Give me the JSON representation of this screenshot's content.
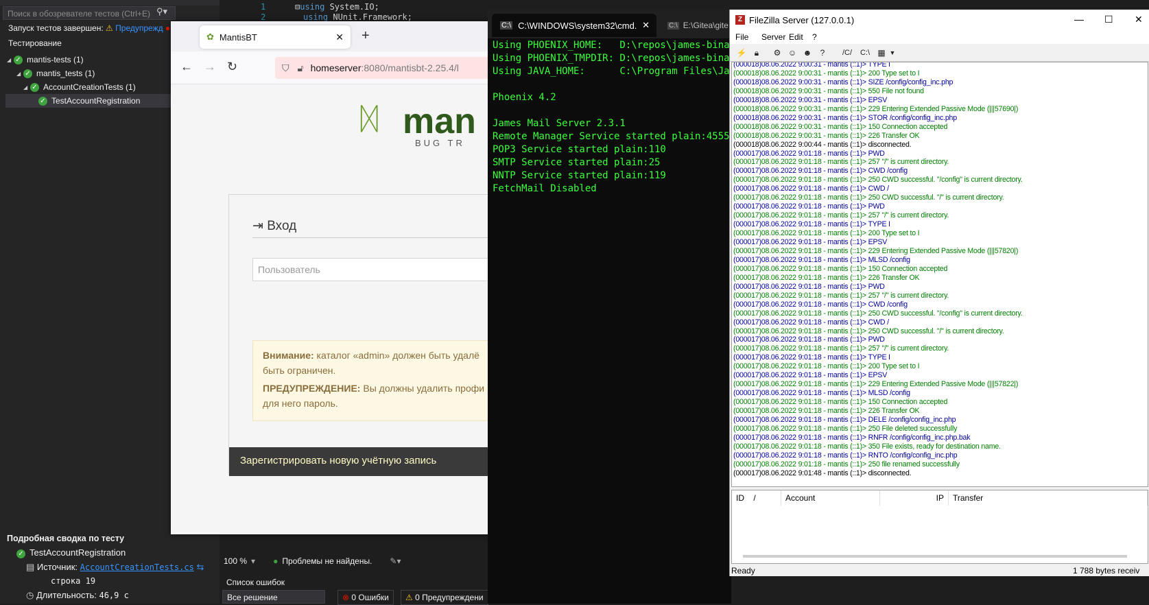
{
  "vs": {
    "search_placeholder": "Поиск в обозревателе тестов (Ctrl+E)",
    "status_text": "Запуск тестов завершен:",
    "status_warning": "Предупрежд",
    "group_header": "Тестирование",
    "tree": [
      {
        "label": "mantis-tests (1)"
      },
      {
        "label": "mantis_tests (1)"
      },
      {
        "label": "AccountCreationTests (1)"
      },
      {
        "label": "TestAccountRegistration"
      }
    ],
    "code": [
      {
        "num": "1",
        "kw": "using",
        "rest": " System.IO;"
      },
      {
        "num": "2",
        "kw": "using",
        "rest": " NUnit.Framework;"
      }
    ],
    "summary": {
      "title": "Подробная сводка по тесту",
      "test_name": "TestAccountRegistration",
      "source_label": "Источник:",
      "source_link": "AccountCreationTests.cs",
      "line_label": "строка",
      "line_num": "19",
      "duration_label": "Длительность:",
      "duration": "46,9 с"
    },
    "bottom": {
      "zoom": "100 %",
      "problems": "Проблемы не найдены.",
      "errors_title": "Список ошибок",
      "scope": "Все решение",
      "errors": "0 Ошибки",
      "warnings": "0 Предупреждени"
    }
  },
  "browser": {
    "tab_title": "MantisBT",
    "url_host": "homeserver",
    "url_rest": ":8080/mantisbt-2.25.4/l",
    "logo_text": "man",
    "logo_sub": "BUG TR",
    "login_title": "Вход",
    "username_placeholder": "Пользователь",
    "alert_label1": "Внимание:",
    "alert_text1": " каталог «admin» должен быть удалё быть ограничен.",
    "alert_label2": "ПРЕДУПРЕЖДЕНИЕ:",
    "alert_text2": " Вы должны удалить профи для него пароль.",
    "register_link": "Зарегистрировать новую учётную запись"
  },
  "cmd": {
    "tab_title": "C:\\WINDOWS\\system32\\cmd.",
    "tab2_title": "E:\\Gitea\\gite",
    "lines": [
      "Using PHOENIX_HOME:   D:\\repos\\james-binary",
      "Using PHOENIX_TMPDIR: D:\\repos\\james-binary",
      "Using JAVA_HOME:      C:\\Program Files\\Java",
      "",
      "Phoenix 4.2",
      "",
      "James Mail Server 2.3.1",
      "Remote Manager Service started plain:4555",
      "POP3 Service started plain:110",
      "SMTP Service started plain:25",
      "NNTP Service started plain:119",
      "FetchMail Disabled"
    ]
  },
  "filezilla": {
    "title": "FileZilla Server (127.0.0.1)",
    "menu": [
      "File",
      "Server",
      "Edit",
      "?"
    ],
    "toolbar_paths": [
      "/C/",
      "C:\\"
    ],
    "log": [
      {
        "t": "(000018)08.06.2022 9:00:31 - mantis (::1)> TYPE I",
        "k": "c-cmd"
      },
      {
        "t": "(000018)08.06.2022 9:00:31 - mantis (::1)> 200 Type set to I",
        "k": "c-res"
      },
      {
        "t": "(000018)08.06.2022 9:00:31 - mantis (::1)> SIZE /config/config_inc.php",
        "k": "c-cmd"
      },
      {
        "t": "(000018)08.06.2022 9:00:31 - mantis (::1)> 550 File not found",
        "k": "c-res"
      },
      {
        "t": "(000018)08.06.2022 9:00:31 - mantis (::1)> EPSV",
        "k": "c-cmd"
      },
      {
        "t": "(000018)08.06.2022 9:00:31 - mantis (::1)> 229 Entering Extended Passive Mode (|||57690|)",
        "k": "c-res"
      },
      {
        "t": "(000018)08.06.2022 9:00:31 - mantis (::1)> STOR /config/config_inc.php",
        "k": "c-cmd"
      },
      {
        "t": "(000018)08.06.2022 9:00:31 - mantis (::1)> 150 Connection accepted",
        "k": "c-res"
      },
      {
        "t": "(000018)08.06.2022 9:00:31 - mantis (::1)> 226 Transfer OK",
        "k": "c-res"
      },
      {
        "t": "(000018)08.06.2022 9:00:44 - mantis (::1)> disconnected.",
        "k": "c-plain"
      },
      {
        "t": "(000017)08.06.2022 9:01:18 - mantis (::1)> PWD",
        "k": "c-cmd"
      },
      {
        "t": "(000017)08.06.2022 9:01:18 - mantis (::1)> 257 \"/\" is current directory.",
        "k": "c-res"
      },
      {
        "t": "(000017)08.06.2022 9:01:18 - mantis (::1)> CWD /config",
        "k": "c-cmd"
      },
      {
        "t": "(000017)08.06.2022 9:01:18 - mantis (::1)> 250 CWD successful. \"/config\" is current directory.",
        "k": "c-res"
      },
      {
        "t": "(000017)08.06.2022 9:01:18 - mantis (::1)> CWD /",
        "k": "c-cmd"
      },
      {
        "t": "(000017)08.06.2022 9:01:18 - mantis (::1)> 250 CWD successful. \"/\" is current directory.",
        "k": "c-res"
      },
      {
        "t": "(000017)08.06.2022 9:01:18 - mantis (::1)> PWD",
        "k": "c-cmd"
      },
      {
        "t": "(000017)08.06.2022 9:01:18 - mantis (::1)> 257 \"/\" is current directory.",
        "k": "c-res"
      },
      {
        "t": "(000017)08.06.2022 9:01:18 - mantis (::1)> TYPE I",
        "k": "c-cmd"
      },
      {
        "t": "(000017)08.06.2022 9:01:18 - mantis (::1)> 200 Type set to I",
        "k": "c-res"
      },
      {
        "t": "(000017)08.06.2022 9:01:18 - mantis (::1)> EPSV",
        "k": "c-cmd"
      },
      {
        "t": "(000017)08.06.2022 9:01:18 - mantis (::1)> 229 Entering Extended Passive Mode (|||57820|)",
        "k": "c-res"
      },
      {
        "t": "(000017)08.06.2022 9:01:18 - mantis (::1)> MLSD /config",
        "k": "c-cmd"
      },
      {
        "t": "(000017)08.06.2022 9:01:18 - mantis (::1)> 150 Connection accepted",
        "k": "c-res"
      },
      {
        "t": "(000017)08.06.2022 9:01:18 - mantis (::1)> 226 Transfer OK",
        "k": "c-res"
      },
      {
        "t": "(000017)08.06.2022 9:01:18 - mantis (::1)> PWD",
        "k": "c-cmd"
      },
      {
        "t": "(000017)08.06.2022 9:01:18 - mantis (::1)> 257 \"/\" is current directory.",
        "k": "c-res"
      },
      {
        "t": "(000017)08.06.2022 9:01:18 - mantis (::1)> CWD /config",
        "k": "c-cmd"
      },
      {
        "t": "(000017)08.06.2022 9:01:18 - mantis (::1)> 250 CWD successful. \"/config\" is current directory.",
        "k": "c-res"
      },
      {
        "t": "(000017)08.06.2022 9:01:18 - mantis (::1)> CWD /",
        "k": "c-cmd"
      },
      {
        "t": "(000017)08.06.2022 9:01:18 - mantis (::1)> 250 CWD successful. \"/\" is current directory.",
        "k": "c-res"
      },
      {
        "t": "(000017)08.06.2022 9:01:18 - mantis (::1)> PWD",
        "k": "c-cmd"
      },
      {
        "t": "(000017)08.06.2022 9:01:18 - mantis (::1)> 257 \"/\" is current directory.",
        "k": "c-res"
      },
      {
        "t": "(000017)08.06.2022 9:01:18 - mantis (::1)> TYPE I",
        "k": "c-cmd"
      },
      {
        "t": "(000017)08.06.2022 9:01:18 - mantis (::1)> 200 Type set to I",
        "k": "c-res"
      },
      {
        "t": "(000017)08.06.2022 9:01:18 - mantis (::1)> EPSV",
        "k": "c-cmd"
      },
      {
        "t": "(000017)08.06.2022 9:01:18 - mantis (::1)> 229 Entering Extended Passive Mode (|||57822|)",
        "k": "c-res"
      },
      {
        "t": "(000017)08.06.2022 9:01:18 - mantis (::1)> MLSD /config",
        "k": "c-cmd"
      },
      {
        "t": "(000017)08.06.2022 9:01:18 - mantis (::1)> 150 Connection accepted",
        "k": "c-res"
      },
      {
        "t": "(000017)08.06.2022 9:01:18 - mantis (::1)> 226 Transfer OK",
        "k": "c-res"
      },
      {
        "t": "(000017)08.06.2022 9:01:18 - mantis (::1)> DELE /config/config_inc.php",
        "k": "c-cmd"
      },
      {
        "t": "(000017)08.06.2022 9:01:18 - mantis (::1)> 250 File deleted successfully",
        "k": "c-res"
      },
      {
        "t": "(000017)08.06.2022 9:01:18 - mantis (::1)> RNFR /config/config_inc.php.bak",
        "k": "c-cmd"
      },
      {
        "t": "(000017)08.06.2022 9:01:18 - mantis (::1)> 350 File exists, ready for destination name.",
        "k": "c-res"
      },
      {
        "t": "(000017)08.06.2022 9:01:18 - mantis (::1)> RNTO /config/config_inc.php",
        "k": "c-cmd"
      },
      {
        "t": "(000017)08.06.2022 9:01:18 - mantis (::1)> 250 file renamed successfully",
        "k": "c-res"
      },
      {
        "t": "(000017)08.06.2022 9:01:48 - mantis (::1)> disconnected.",
        "k": "c-plain"
      }
    ],
    "columns": {
      "id": "ID",
      "sort": "/",
      "account": "Account",
      "ip": "IP",
      "transfer": "Transfer"
    },
    "status_left": "Ready",
    "status_right": "1 788 bytes receiv"
  }
}
